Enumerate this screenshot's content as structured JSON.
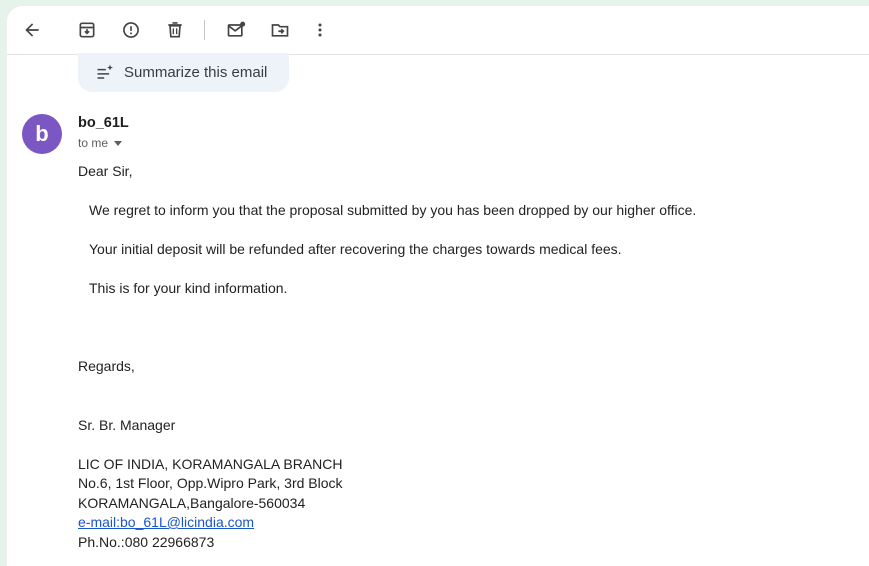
{
  "toolbar": {
    "icons": [
      "back-arrow-icon",
      "archive-icon",
      "report-spam-icon",
      "delete-icon",
      "mark-unread-icon",
      "move-to-icon",
      "more-vert-icon"
    ]
  },
  "summarize": {
    "label": "Summarize this email"
  },
  "sender": {
    "avatar_letter": "b",
    "avatar_color": "#7b57c4",
    "name": "bo_61L",
    "recipient": "to me"
  },
  "email": {
    "greeting": "Dear Sir,",
    "para1": "We regret to inform you that the proposal submitted by you has been dropped by our higher office.",
    "para2": "Your initial deposit will be refunded after recovering the charges towards medical fees.",
    "para3": "This is for your kind information.",
    "closing": "Regards,",
    "signature_title": "Sr. Br. Manager",
    "org": "LIC OF INDIA, KORAMANGALA BRANCH",
    "address1": "No.6, 1st Floor, Opp.Wipro Park, 3rd Block",
    "address2": "KORAMANGALA,Bangalore-560034",
    "email_link": "e-mail:bo_61L@licindia.com",
    "phone": "Ph.No.:080 22966873"
  },
  "colors": {
    "link": "#1a55c9",
    "app_background": "#e6f3ea"
  }
}
